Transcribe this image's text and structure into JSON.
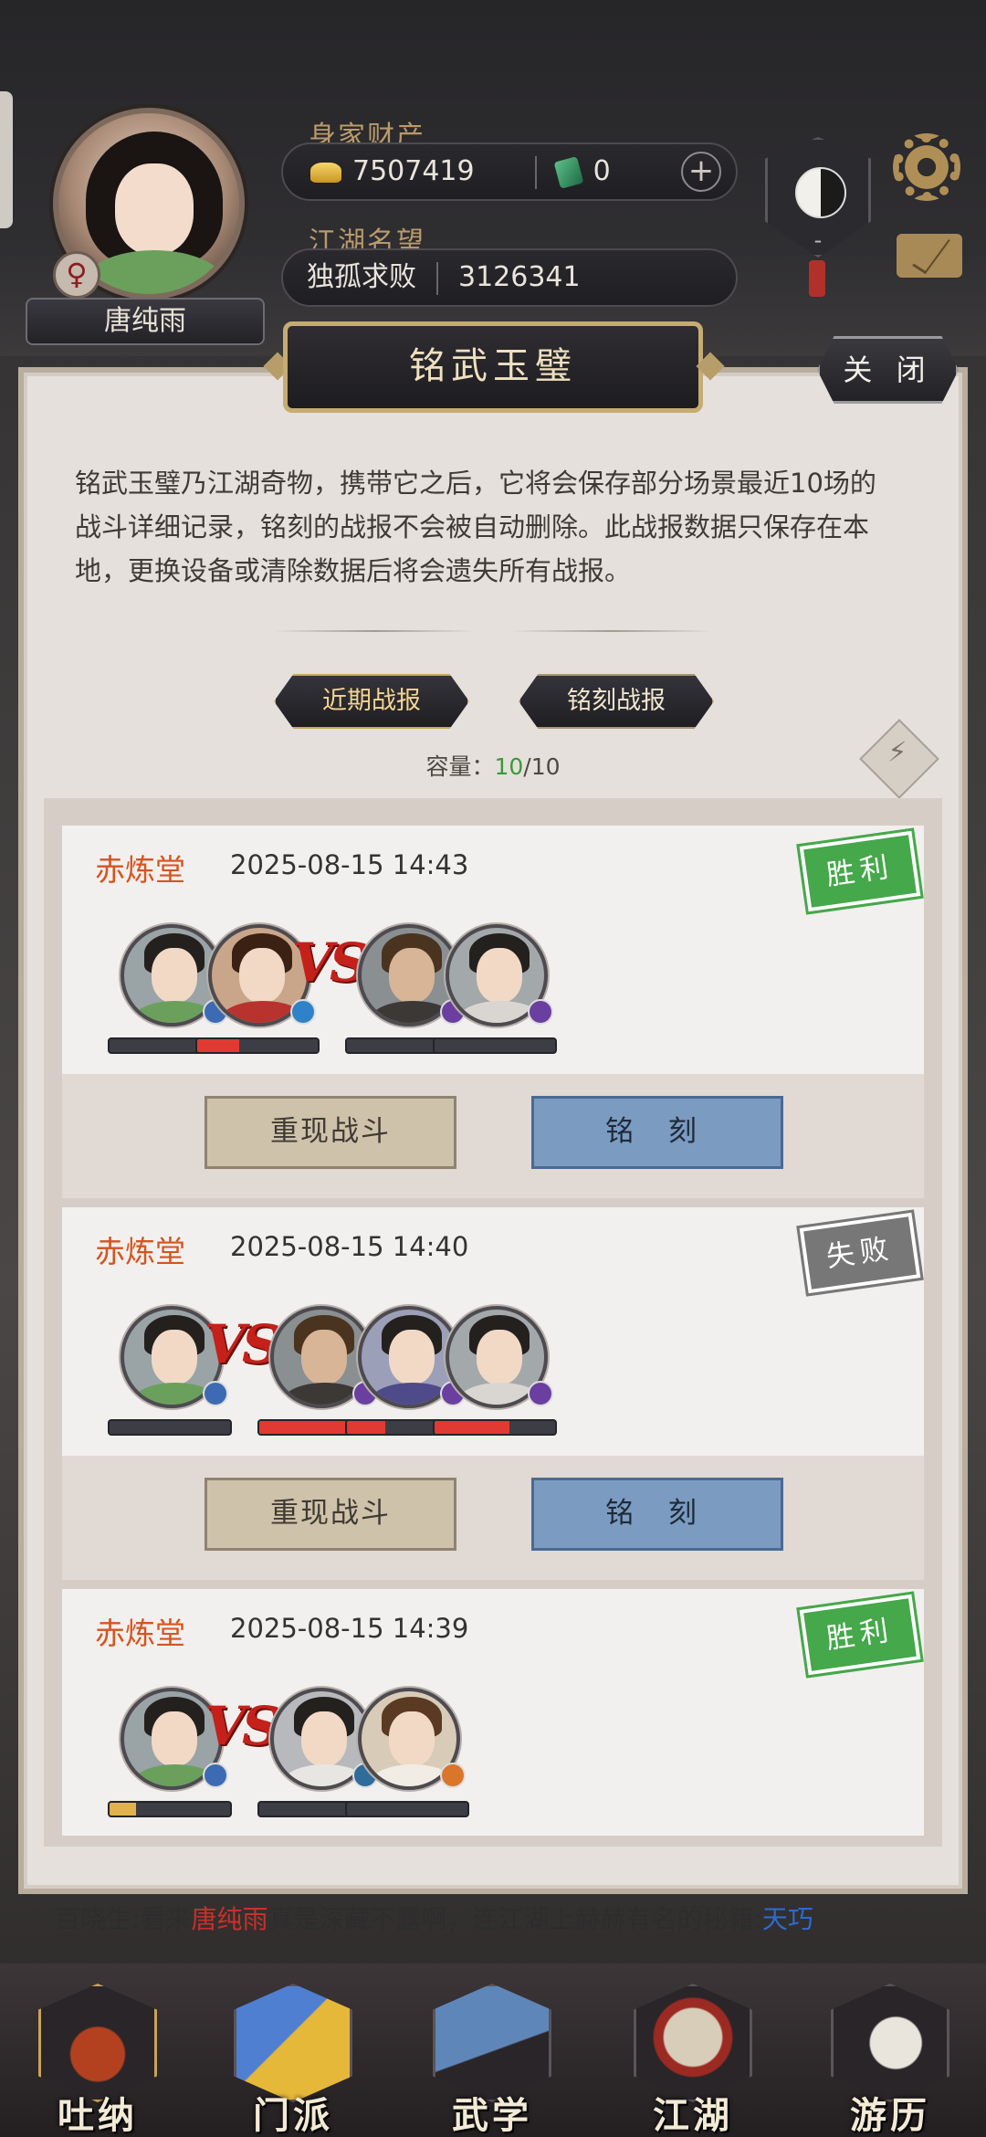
{
  "player": {
    "name": "唐纯雨",
    "gender_symbol": "♀",
    "wealth_label": "身家财产",
    "gold": "7507419",
    "jade": "0",
    "add_symbol": "+",
    "fame_label": "江湖名望",
    "fame_title": "独孤求败",
    "fame_value": "3126341",
    "taichi_text": "-"
  },
  "modal": {
    "title": "铭武玉璧",
    "close_label": "关 闭",
    "description": "铭武玉璧乃江湖奇物，携带它之后，它将会保存部分场景最近10场的战斗详细记录，铭刻的战报不会被自动删除。此战报数据只保存在本地，更换设备或清除数据后将会遗失所有战报。",
    "tabs": [
      {
        "label": "近期战报",
        "active": true
      },
      {
        "label": "铭刻战报",
        "active": false
      }
    ],
    "capacity_label": "容量：",
    "capacity_current": "10",
    "capacity_max": "/10"
  },
  "records": [
    {
      "venue": "赤炼堂",
      "time": "2025-08-15 14:43",
      "result": "胜利",
      "allies_hp": [
        0,
        0.35
      ],
      "enemies_hp": [
        0,
        0
      ],
      "replay_label": "重现战斗",
      "engrave_label": "铭 刻"
    },
    {
      "venue": "赤炼堂",
      "time": "2025-08-15 14:40",
      "result": "失败",
      "allies_hp": [
        0
      ],
      "enemies_hp": [
        0.8,
        0.32,
        0.62
      ],
      "replay_label": "重现战斗",
      "engrave_label": "铭 刻"
    },
    {
      "venue": "赤炼堂",
      "time": "2025-08-15 14:39",
      "result": "胜利",
      "allies_hp": [
        0.22
      ],
      "enemies_hp": [
        0,
        0
      ]
    }
  ],
  "vs_text": "VS",
  "ticker": {
    "prefix": "百晓生:看来",
    "name": "唐纯雨",
    "middle": "真是深藏不露啊，连江湖上赫赫有名的秘籍:",
    "book": "天巧"
  },
  "nav": [
    {
      "label": "吐纳",
      "active": true
    },
    {
      "label": "门派",
      "active": false
    },
    {
      "label": "武学",
      "active": false
    },
    {
      "label": "江湖",
      "active": false
    },
    {
      "label": "游历",
      "active": false
    }
  ],
  "colors": {
    "win": "#45a84a",
    "lose": "#777777",
    "hp_red": "#e03a32",
    "hp_gold": "#e2b24a",
    "venue": "#d6541f"
  }
}
